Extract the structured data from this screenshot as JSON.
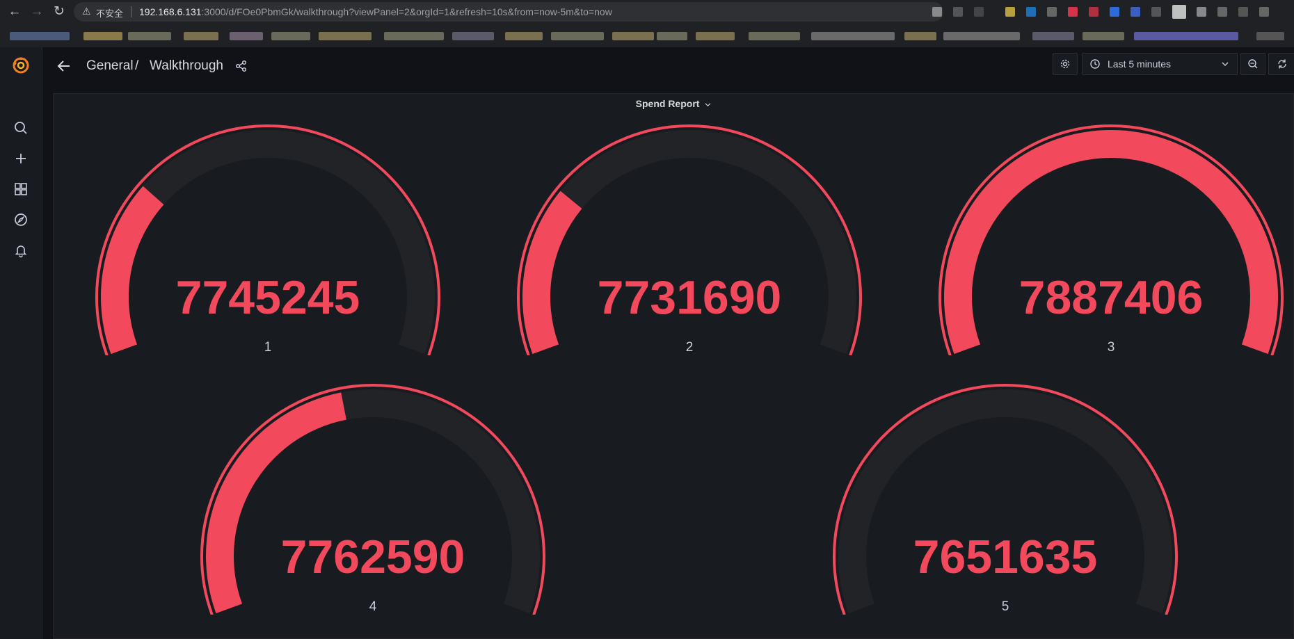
{
  "browser": {
    "insecure_label": "不安全",
    "url_host": "192.168.6.131",
    "url_rest": ":3000/d/FOe0PbmGk/walkthrough?viewPanel=2&orgId=1&refresh=10s&from=now-5m&to=now"
  },
  "breadcrumb": {
    "folder": "General",
    "separator": "/",
    "dashboard": "Walkthrough"
  },
  "toolbar": {
    "time_range": "Last 5 minutes",
    "refresh_interval": "10s"
  },
  "panel": {
    "title": "Spend Report",
    "gauge_color": "#f2495c",
    "track_color": "#222327",
    "gauges": [
      {
        "label": "1",
        "value": "7745245",
        "fill": 0.28
      },
      {
        "label": "2",
        "value": "7731690",
        "fill": 0.27
      },
      {
        "label": "3",
        "value": "7887406",
        "fill": 1.0
      },
      {
        "label": "4",
        "value": "7762590",
        "fill": 0.45
      },
      {
        "label": "5",
        "value": "7651635",
        "fill": 0.0
      }
    ]
  }
}
